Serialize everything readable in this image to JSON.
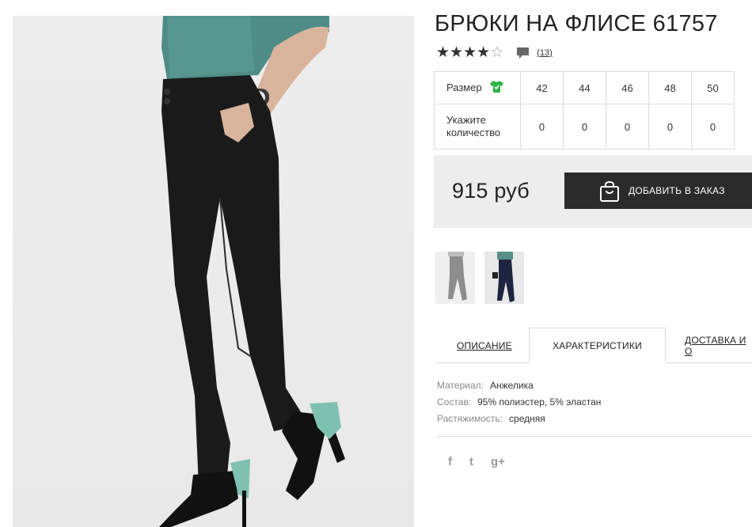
{
  "product": {
    "title": "БРЮКИ НА ФЛИСЕ 61757",
    "rating": 4,
    "rating_max": 5,
    "review_count": "(13)"
  },
  "sizes": {
    "size_label": "Размер",
    "qty_label": "Укажите количество",
    "values": [
      "42",
      "44",
      "46",
      "48",
      "50"
    ],
    "quantities": [
      "0",
      "0",
      "0",
      "0",
      "0"
    ]
  },
  "purchase": {
    "price": "915 руб",
    "add_button": "ДОБАВИТЬ В ЗАКАЗ"
  },
  "tabs": {
    "description": "ОПИСАНИЕ",
    "characteristics": "ХАРАКТЕРИСТИКИ",
    "delivery": "ДОСТАВКА И О"
  },
  "specs": [
    {
      "key": "Материал:",
      "value": "Анжелика"
    },
    {
      "key": "Состав:",
      "value": "95% полиэстер, 5% эластан"
    },
    {
      "key": "Растяжимость:",
      "value": "средняя"
    }
  ],
  "social": {
    "facebook": "f",
    "twitter": "t",
    "google": "g+"
  },
  "colors": {
    "accent_green": "#2fb34a",
    "button_dark": "#2b2b2b",
    "price_bg": "#ededed"
  },
  "icons": [
    "tshirt-icon",
    "comment-icon",
    "bag-icon",
    "facebook-icon",
    "twitter-icon",
    "google-plus-icon"
  ]
}
